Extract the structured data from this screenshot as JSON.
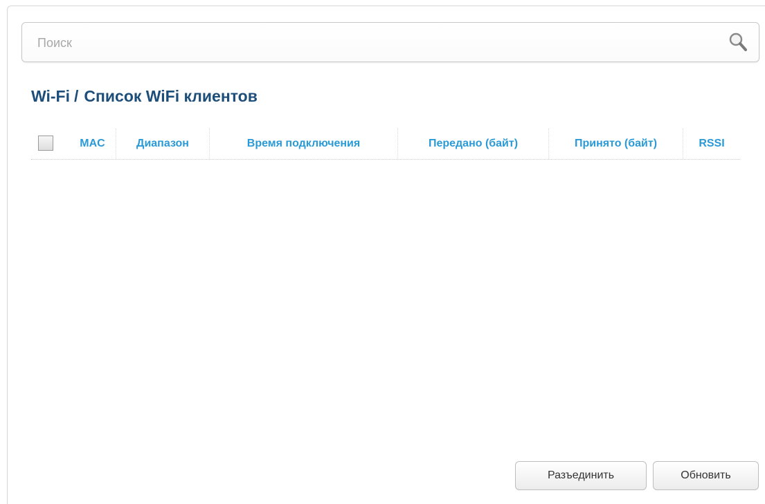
{
  "search": {
    "placeholder": "Поиск",
    "icon": "search-icon"
  },
  "breadcrumb": {
    "section": "Wi-Fi",
    "separator": "/",
    "page": "Список WiFi клиентов"
  },
  "table": {
    "columns": [
      "MAC",
      "Диапазон",
      "Время подключения",
      "Передано (байт)",
      "Принято (байт)",
      "RSSI"
    ],
    "rows": []
  },
  "actions": {
    "disconnect_label": "Разъединить",
    "refresh_label": "Обновить"
  },
  "colors": {
    "title": "#1d4e7a",
    "column_header": "#2a9ad6"
  }
}
